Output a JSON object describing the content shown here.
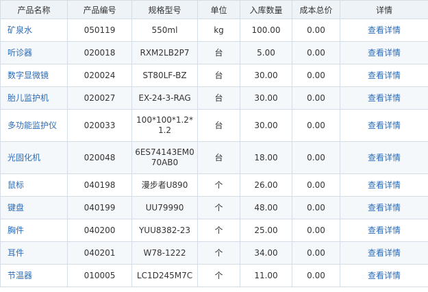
{
  "columns": {
    "name": "产品名称",
    "code": "产品编号",
    "spec": "规格型号",
    "unit": "单位",
    "qty": "入库数量",
    "cost": "成本总价",
    "detail": "详情"
  },
  "detail_link_label": "查看详情",
  "rows": [
    {
      "name": "矿泉水",
      "code": "050119",
      "spec": "550ml",
      "unit": "kg",
      "qty": "100.00",
      "cost": "0.00"
    },
    {
      "name": "听诊器",
      "code": "020018",
      "spec": "RXM2LB2P7",
      "unit": "台",
      "qty": "5.00",
      "cost": "0.00"
    },
    {
      "name": "数字显微镜",
      "code": "020024",
      "spec": "ST80LF-BZ",
      "unit": "台",
      "qty": "30.00",
      "cost": "0.00"
    },
    {
      "name": "胎儿监护机",
      "code": "020027",
      "spec": "EX-24-3-RAG",
      "unit": "台",
      "qty": "30.00",
      "cost": "0.00"
    },
    {
      "name": "多功能监护仪",
      "code": "020033",
      "spec": "100*100*1.2*1.2",
      "unit": "台",
      "qty": "30.00",
      "cost": "0.00"
    },
    {
      "name": "光固化机",
      "code": "020048",
      "spec": "6ES74143EM070AB0",
      "unit": "台",
      "qty": "18.00",
      "cost": "0.00"
    },
    {
      "name": "鼠标",
      "code": "040198",
      "spec": "漫步者U890",
      "unit": "个",
      "qty": "26.00",
      "cost": "0.00"
    },
    {
      "name": "键盘",
      "code": "040199",
      "spec": "UU79990",
      "unit": "个",
      "qty": "48.00",
      "cost": "0.00"
    },
    {
      "name": "胸件",
      "code": "040200",
      "spec": "YUU8382-23",
      "unit": "个",
      "qty": "25.00",
      "cost": "0.00"
    },
    {
      "name": "耳件",
      "code": "040201",
      "spec": "W78-1222",
      "unit": "个",
      "qty": "34.00",
      "cost": "0.00"
    },
    {
      "name": "节温器",
      "code": "010005",
      "spec": "LC1D245M7C",
      "unit": "个",
      "qty": "11.00",
      "cost": "0.00"
    }
  ]
}
